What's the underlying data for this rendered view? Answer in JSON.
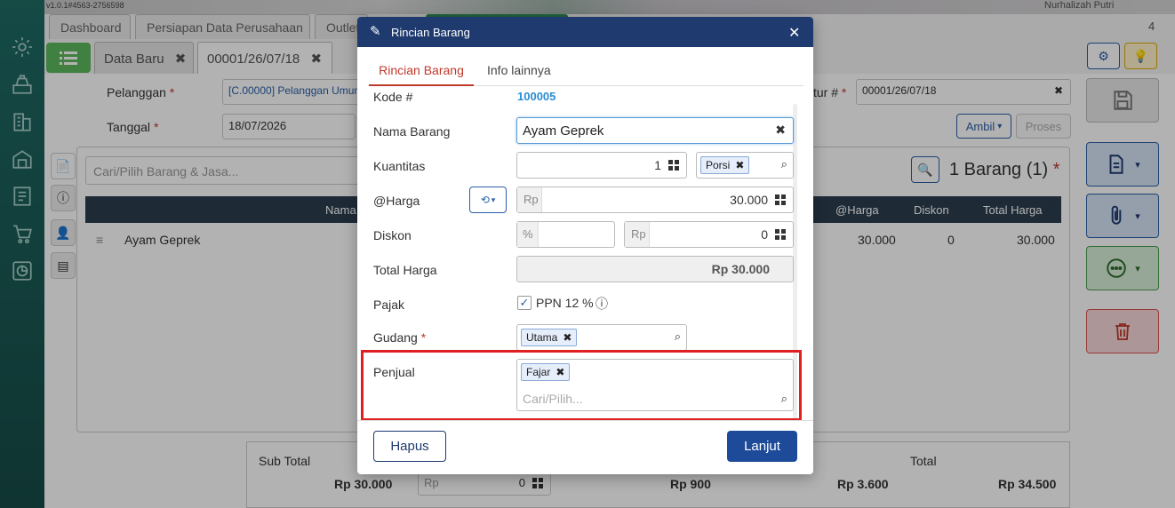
{
  "app": {
    "version": "v1.0.1#4563-2756598",
    "user": "Nurhalizah Putri",
    "tab_count": "4"
  },
  "top_tabs": [
    "Dashboard",
    "Persiapan Data Perusahaan",
    "Outlet"
  ],
  "doc_tabs": [
    {
      "label": "Data Baru"
    },
    {
      "label": "00001/26/07/18"
    }
  ],
  "form": {
    "pelanggan_label": "Pelanggan",
    "pelanggan_value": "[C.00000] Pelanggan Umum",
    "tanggal_label": "Tanggal",
    "tanggal_value": "18/07/2026",
    "faktur_label": "tur #",
    "faktur_value": "00001/26/07/18",
    "ambil_label": "Ambil",
    "proses_label": "Proses"
  },
  "items": {
    "search_placeholder": "Cari/Pilih Barang & Jasa...",
    "count_label": "1 Barang (1)",
    "columns": [
      "Nama",
      "@Harga",
      "Diskon",
      "Total Harga"
    ],
    "rows": [
      {
        "name": "Ayam Geprek",
        "harga": "30.000",
        "diskon": "0",
        "total": "30.000"
      }
    ]
  },
  "footer": {
    "subtotal_label": "Sub Total",
    "subtotal_value": "Rp 30.000",
    "disc_prefix": "Rp",
    "disc_value": "0",
    "pajak_value": "Rp 900",
    "biaya_value": "Rp 3.600",
    "total_label": "Total",
    "total_value": "Rp 34.500"
  },
  "modal": {
    "title": "Rincian Barang",
    "tabs": [
      "Rincian Barang",
      "Info lainnya"
    ],
    "kode_label": "Kode #",
    "kode_value": "100005",
    "nama_label": "Nama Barang",
    "nama_value": "Ayam Geprek",
    "qty_label": "Kuantitas",
    "qty_value": "1",
    "unit_tag": "Porsi",
    "harga_label": "@Harga",
    "harga_prefix": "Rp",
    "harga_value": "30.000",
    "diskon_label": "Diskon",
    "diskon_pct_prefix": "%",
    "diskon_rp_prefix": "Rp",
    "diskon_value": "0",
    "total_label": "Total Harga",
    "total_value": "Rp 30.000",
    "pajak_label": "Pajak",
    "ppn_label": "PPN 12 %",
    "gudang_label": "Gudang",
    "gudang_tag": "Utama",
    "penjual_label": "Penjual",
    "penjual_tag": "Fajar",
    "penjual_placeholder": "Cari/Pilih...",
    "hapus_label": "Hapus",
    "lanjut_label": "Lanjut"
  },
  "colors": {
    "modal_header": "#1e3a6e",
    "accent_red": "#c0392b",
    "highlight_box": "#e02020",
    "link_blue": "#2a8dd4"
  }
}
